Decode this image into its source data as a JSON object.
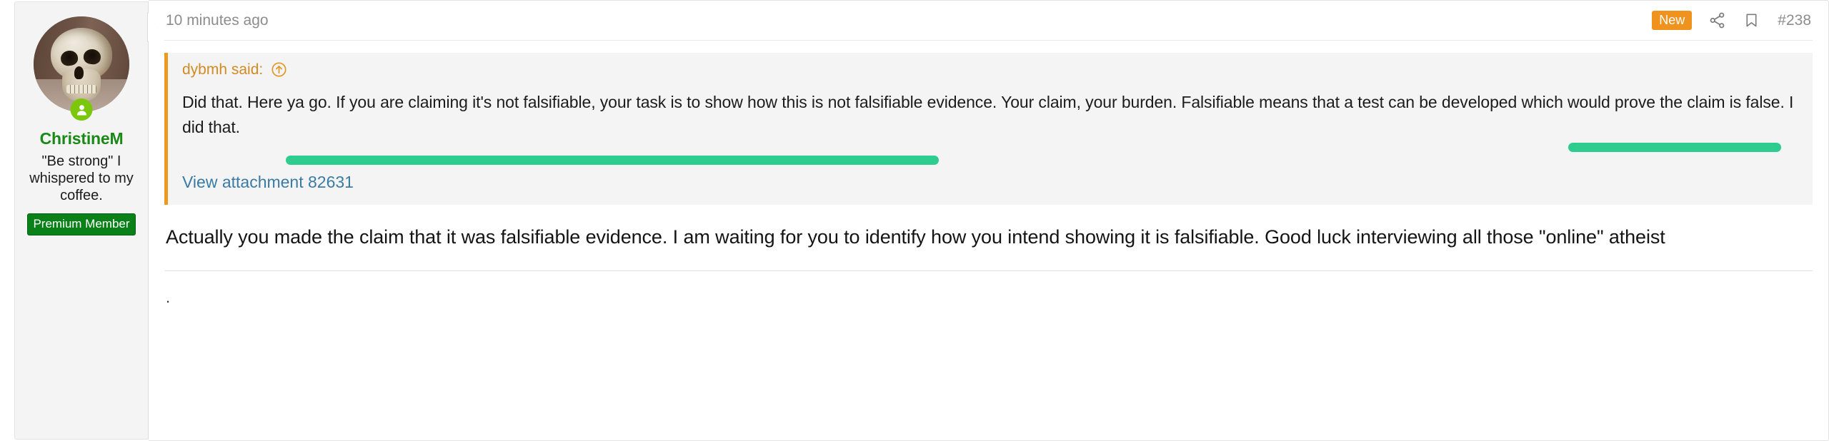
{
  "sidebar": {
    "avatar_alt": "skull-avatar",
    "online_status_icon": "user-online-icon",
    "username": "ChristineM",
    "user_title": "\"Be strong\" I whispered to my coffee.",
    "member_badge": "Premium Member",
    "username_color": "#1a8917",
    "badge_bg": "#0a8018",
    "online_color": "#7ac70c"
  },
  "header": {
    "timestamp": "10 minutes ago",
    "new_badge": "New",
    "new_badge_color": "#f0921e",
    "share_icon": "share-icon",
    "bookmark_icon": "bookmark-icon",
    "post_number": "#238"
  },
  "quote": {
    "author_label": "dybmh said:",
    "jump_icon": "circle-arrow-up-icon",
    "accent_color": "#ec9a1e",
    "background": "#f4f4f4",
    "text": "Did that. Here ya go. If you are claiming it's not falsifiable, your task is to show how this is not falsifiable evidence. Your claim, your burden. Falsifiable means that a test can be developed which would prove the claim is false. I did that.",
    "redaction_color": "#2ecc8f",
    "attachment_link": "View attachment 82631",
    "attachment_link_color": "#3a7ba5"
  },
  "message": {
    "text": "Actually you made the claim that it was falsifiable evidence. I am waiting for you to identify how you intend showing it is falsifiable. Good luck interviewing all those \"online\" atheist",
    "footer_text": "."
  }
}
